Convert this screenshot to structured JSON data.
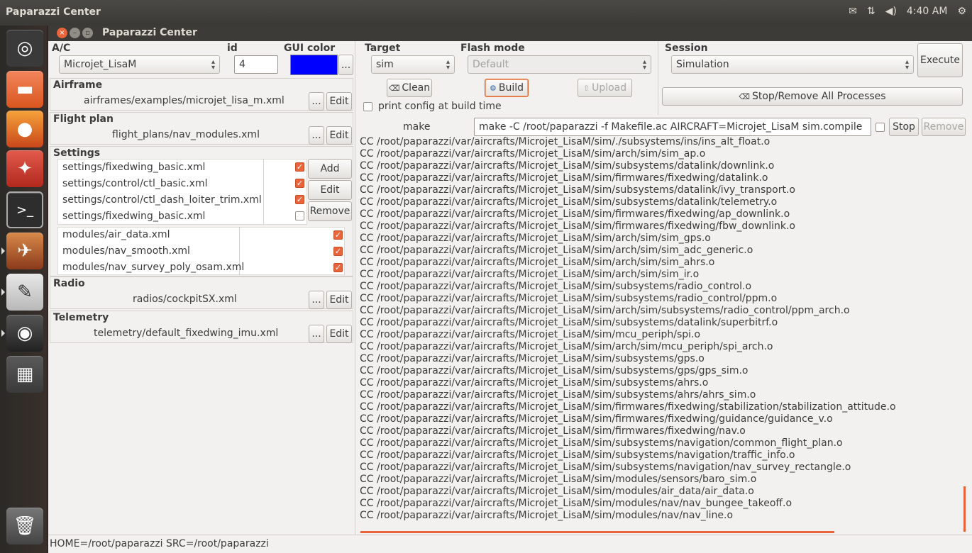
{
  "system_panel": {
    "app_title": "Paparazzi Center",
    "time": "4:40 AM",
    "icons": [
      "mail-icon",
      "network-icon",
      "volume-icon",
      "settings-icon"
    ]
  },
  "launcher": {
    "items": [
      {
        "name": "ubuntu-dash-icon",
        "glyph": "◎"
      },
      {
        "name": "files-icon",
        "glyph": "▭"
      },
      {
        "name": "firefox-icon",
        "glyph": "●"
      },
      {
        "name": "system-settings-icon",
        "glyph": "✦"
      },
      {
        "name": "terminal-icon",
        "glyph": ">_"
      },
      {
        "name": "paparazzi-icon",
        "glyph": "✈"
      },
      {
        "name": "text-editor-icon",
        "glyph": "✎"
      },
      {
        "name": "disk-icon",
        "glyph": "◉"
      },
      {
        "name": "workspace-switcher-icon",
        "glyph": "▦"
      },
      {
        "name": "trash-icon",
        "glyph": "🗑"
      }
    ]
  },
  "window": {
    "title": "Paparazzi Center"
  },
  "ac": {
    "label": "A/C",
    "selected": "Microjet_LisaM",
    "id_label": "id",
    "id_value": "4",
    "gui_color_label": "GUI color",
    "gui_color": "#0000ff",
    "color_button": "..."
  },
  "airframe": {
    "label": "Airframe",
    "path": "airframes/examples/microjet_lisa_m.xml",
    "browse": "...",
    "edit": "Edit"
  },
  "flight_plan": {
    "label": "Flight plan",
    "path": "flight_plans/nav_modules.xml",
    "browse": "...",
    "edit": "Edit"
  },
  "settings": {
    "label": "Settings",
    "items": [
      {
        "path": "settings/fixedwing_basic.xml",
        "checked": true
      },
      {
        "path": "settings/control/ctl_basic.xml",
        "checked": true
      },
      {
        "path": "settings/control/ctl_dash_loiter_trim.xml",
        "checked": true
      },
      {
        "path": "settings/fixedwing_basic.xml",
        "checked": false
      }
    ],
    "modules": [
      {
        "path": "modules/air_data.xml",
        "checked": true
      },
      {
        "path": "modules/nav_smooth.xml",
        "checked": true
      },
      {
        "path": "modules/nav_survey_poly_osam.xml",
        "checked": true
      }
    ],
    "add": "Add",
    "edit": "Edit",
    "remove": "Remove"
  },
  "radio": {
    "label": "Radio",
    "path": "radios/cockpitSX.xml",
    "browse": "...",
    "edit": "Edit"
  },
  "telemetry": {
    "label": "Telemetry",
    "path": "telemetry/default_fixedwing_imu.xml",
    "browse": "...",
    "edit": "Edit"
  },
  "build": {
    "target_label": "Target",
    "target_selected": "sim",
    "flash_label": "Flash mode",
    "flash_selected": "Default",
    "clean": "Clean",
    "build": "Build",
    "upload": "Upload",
    "print_config": "print config at build time"
  },
  "session": {
    "label": "Session",
    "selected": "Simulation",
    "execute": "Execute",
    "stop_remove_all": "Stop/Remove All Processes"
  },
  "command": {
    "label": "make",
    "value": "make -C /root/paparazzi -f Makefile.ac AIRCRAFT=Microjet_LisaM sim.compile",
    "stop": "Stop",
    "remove": "Remove"
  },
  "log_lines": [
    "CC /root/paparazzi/var/aircrafts/Microjet_LisaM/sim/./subsystems/ins/ins_alt_float.o",
    "CC /root/paparazzi/var/aircrafts/Microjet_LisaM/sim/arch/sim/sim_ap.o",
    "CC /root/paparazzi/var/aircrafts/Microjet_LisaM/sim/subsystems/datalink/downlink.o",
    "CC /root/paparazzi/var/aircrafts/Microjet_LisaM/sim/firmwares/fixedwing/datalink.o",
    "CC /root/paparazzi/var/aircrafts/Microjet_LisaM/sim/subsystems/datalink/ivy_transport.o",
    "CC /root/paparazzi/var/aircrafts/Microjet_LisaM/sim/subsystems/datalink/telemetry.o",
    "CC /root/paparazzi/var/aircrafts/Microjet_LisaM/sim/firmwares/fixedwing/ap_downlink.o",
    "CC /root/paparazzi/var/aircrafts/Microjet_LisaM/sim/firmwares/fixedwing/fbw_downlink.o",
    "CC /root/paparazzi/var/aircrafts/Microjet_LisaM/sim/arch/sim/sim_gps.o",
    "CC /root/paparazzi/var/aircrafts/Microjet_LisaM/sim/arch/sim/sim_adc_generic.o",
    "CC /root/paparazzi/var/aircrafts/Microjet_LisaM/sim/arch/sim/sim_ahrs.o",
    "CC /root/paparazzi/var/aircrafts/Microjet_LisaM/sim/arch/sim/sim_ir.o",
    "CC /root/paparazzi/var/aircrafts/Microjet_LisaM/sim/subsystems/radio_control.o",
    "CC /root/paparazzi/var/aircrafts/Microjet_LisaM/sim/subsystems/radio_control/ppm.o",
    "CC /root/paparazzi/var/aircrafts/Microjet_LisaM/sim/arch/sim/subsystems/radio_control/ppm_arch.o",
    "CC /root/paparazzi/var/aircrafts/Microjet_LisaM/sim/subsystems/datalink/superbitrf.o",
    "CC /root/paparazzi/var/aircrafts/Microjet_LisaM/sim/mcu_periph/spi.o",
    "CC /root/paparazzi/var/aircrafts/Microjet_LisaM/sim/arch/sim/mcu_periph/spi_arch.o",
    "CC /root/paparazzi/var/aircrafts/Microjet_LisaM/sim/subsystems/gps.o",
    "CC /root/paparazzi/var/aircrafts/Microjet_LisaM/sim/subsystems/gps/gps_sim.o",
    "CC /root/paparazzi/var/aircrafts/Microjet_LisaM/sim/subsystems/ahrs.o",
    "CC /root/paparazzi/var/aircrafts/Microjet_LisaM/sim/subsystems/ahrs/ahrs_sim.o",
    "CC /root/paparazzi/var/aircrafts/Microjet_LisaM/sim/firmwares/fixedwing/stabilization/stabilization_attitude.o",
    "CC /root/paparazzi/var/aircrafts/Microjet_LisaM/sim/firmwares/fixedwing/guidance/guidance_v.o",
    "CC /root/paparazzi/var/aircrafts/Microjet_LisaM/sim/firmwares/fixedwing/nav.o",
    "CC /root/paparazzi/var/aircrafts/Microjet_LisaM/sim/subsystems/navigation/common_flight_plan.o",
    "CC /root/paparazzi/var/aircrafts/Microjet_LisaM/sim/subsystems/navigation/traffic_info.o",
    "CC /root/paparazzi/var/aircrafts/Microjet_LisaM/sim/subsystems/navigation/nav_survey_rectangle.o",
    "CC /root/paparazzi/var/aircrafts/Microjet_LisaM/sim/modules/sensors/baro_sim.o",
    "CC /root/paparazzi/var/aircrafts/Microjet_LisaM/sim/modules/air_data/air_data.o",
    "CC /root/paparazzi/var/aircrafts/Microjet_LisaM/sim/modules/nav/nav_bungee_takeoff.o",
    "CC /root/paparazzi/var/aircrafts/Microjet_LisaM/sim/modules/nav/nav_line.o"
  ],
  "status_bar": "HOME=/root/paparazzi SRC=/root/paparazzi",
  "colors": {
    "accent": "#e9643a",
    "panel": "#3c3b37",
    "background": "#f2f1f0"
  }
}
